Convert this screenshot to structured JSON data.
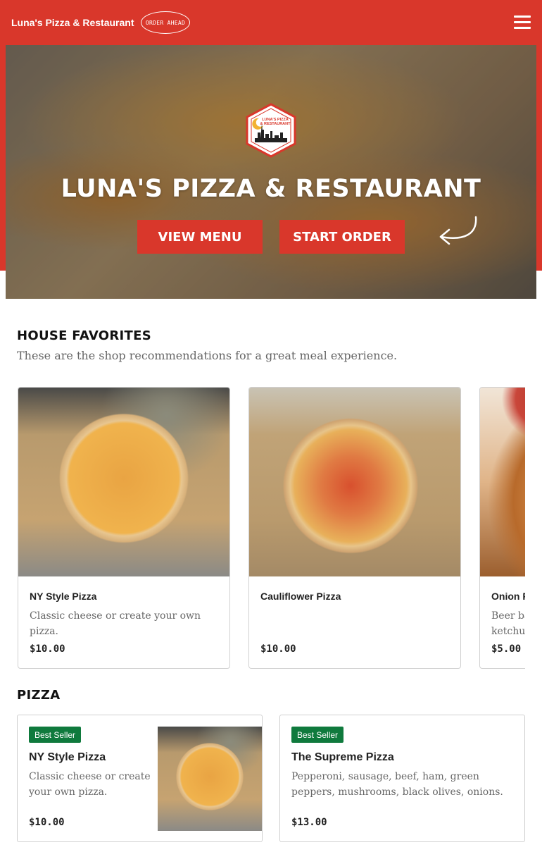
{
  "header": {
    "brand": "Luna's Pizza & Restaurant",
    "order_ahead": "ORDER AHEAD",
    "menu_icon": "hamburger-menu-icon"
  },
  "hero": {
    "logo_text": "LUNA'S PIZZA & RESTAURANT",
    "title": "LUNA'S PIZZA & RESTAURANT",
    "view_menu": "VIEW MENU",
    "start_order": "START ORDER",
    "arrow_icon": "curved-arrow-icon"
  },
  "house_favorites": {
    "title": "HOUSE FAVORITES",
    "subtitle": "These are the shop recommendations for a great meal experience.",
    "items": [
      {
        "name": "NY Style Pizza",
        "description": "Classic cheese or create your own pizza.",
        "price": "$10.00"
      },
      {
        "name": "Cauliflower Pizza",
        "description": "",
        "price": "$10.00"
      },
      {
        "name": "Onion Rings",
        "description": "Beer battered onion rings with ketchup or ranch.",
        "price": "$5.00"
      }
    ]
  },
  "pizza_section": {
    "title": "PIZZA",
    "items": [
      {
        "badge": "Best Seller",
        "name": "NY Style Pizza",
        "description": "Classic cheese or create your own pizza.",
        "price": "$10.00"
      },
      {
        "badge": "Best Seller",
        "name": "The Supreme Pizza",
        "description": "Pepperoni, sausage, beef, ham, green peppers, mushrooms, black olives, onions.",
        "price": "$13.00"
      }
    ]
  },
  "colors": {
    "brand_red": "#d9372b",
    "badge_green": "#0f7a3d"
  }
}
